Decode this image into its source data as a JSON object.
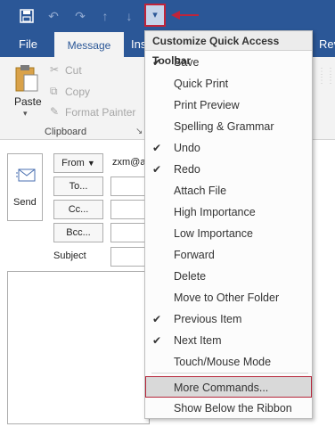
{
  "qat": {
    "icons": [
      "save-icon",
      "undo-icon",
      "redo-icon",
      "previous-item-icon",
      "next-item-icon",
      "customize-dropdown-icon"
    ]
  },
  "tabs": [
    {
      "label": "File"
    },
    {
      "label": "Message"
    },
    {
      "label": "Ins"
    },
    {
      "label": "Rev"
    }
  ],
  "ribbon": {
    "paste_label": "Paste",
    "cut_label": "Cut",
    "copy_label": "Copy",
    "format_painter_label": "Format Painter",
    "group_label": "Clipboard"
  },
  "compose": {
    "send_label": "Send",
    "from_label": "From",
    "from_value": "zxm@a",
    "to_label": "To...",
    "cc_label": "Cc...",
    "bcc_label": "Bcc...",
    "subject_label": "Subject"
  },
  "menu": {
    "title": "Customize Quick Access Toolbar",
    "items": [
      {
        "label": "Save",
        "checked": true
      },
      {
        "label": "Quick Print",
        "checked": false
      },
      {
        "label": "Print Preview",
        "checked": false
      },
      {
        "label": "Spelling & Grammar",
        "checked": false
      },
      {
        "label": "Undo",
        "checked": true
      },
      {
        "label": "Redo",
        "checked": true
      },
      {
        "label": "Attach File",
        "checked": false
      },
      {
        "label": "High Importance",
        "checked": false
      },
      {
        "label": "Low Importance",
        "checked": false
      },
      {
        "label": "Forward",
        "checked": false
      },
      {
        "label": "Delete",
        "checked": false
      },
      {
        "label": "Move to Other Folder",
        "checked": false
      },
      {
        "label": "Previous Item",
        "checked": true
      },
      {
        "label": "Next Item",
        "checked": true
      },
      {
        "label": "Touch/Mouse Mode",
        "checked": false
      }
    ],
    "more_commands": "More Commands...",
    "show_below": "Show Below the Ribbon"
  },
  "colors": {
    "accent": "#2b5797",
    "highlight_border": "#b5263a"
  }
}
